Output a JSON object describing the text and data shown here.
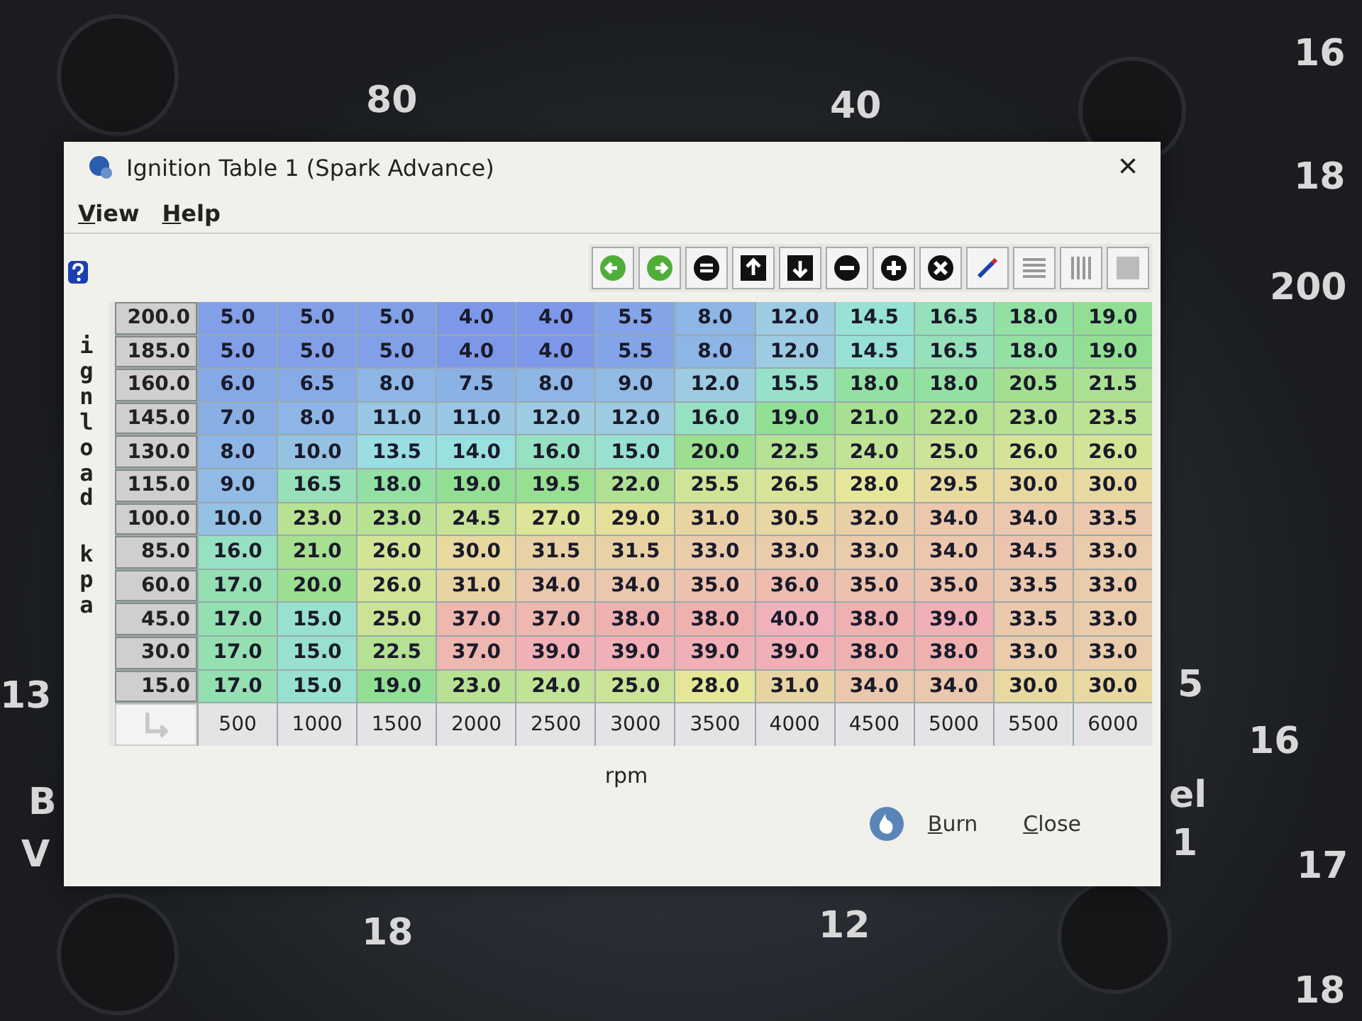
{
  "background": {
    "gauge_labels": [
      "80",
      "40",
      "16",
      "18",
      "200",
      "13",
      "B",
      "V",
      "16",
      "el",
      "1",
      "17",
      "5",
      "18",
      "12",
      "18"
    ]
  },
  "window": {
    "title": "Ignition Table 1 (Spark Advance)",
    "close": "×"
  },
  "menu": [
    "View",
    "Help"
  ],
  "table": {
    "y_axis_label": [
      "ignload",
      "kpa"
    ],
    "x_axis_label": "rpm",
    "rows": [
      {
        "load": "200.0",
        "cells": [
          "5.0",
          "5.0",
          "5.0",
          "4.0",
          "4.0",
          "5.5",
          "8.0",
          "12.0",
          "14.5",
          "16.5",
          "18.0",
          "19.0"
        ]
      },
      {
        "load": "185.0",
        "cells": [
          "5.0",
          "5.0",
          "5.0",
          "4.0",
          "4.0",
          "5.5",
          "8.0",
          "12.0",
          "14.5",
          "16.5",
          "18.0",
          "19.0"
        ]
      },
      {
        "load": "160.0",
        "cells": [
          "6.0",
          "6.5",
          "8.0",
          "7.5",
          "8.0",
          "9.0",
          "12.0",
          "15.5",
          "18.0",
          "18.0",
          "20.5",
          "21.5"
        ]
      },
      {
        "load": "145.0",
        "cells": [
          "7.0",
          "8.0",
          "11.0",
          "11.0",
          "12.0",
          "12.0",
          "16.0",
          "19.0",
          "21.0",
          "22.0",
          "23.0",
          "23.5"
        ]
      },
      {
        "load": "130.0",
        "cells": [
          "8.0",
          "10.0",
          "13.5",
          "14.0",
          "16.0",
          "15.0",
          "20.0",
          "22.5",
          "24.0",
          "25.0",
          "26.0",
          "26.0"
        ]
      },
      {
        "load": "115.0",
        "cells": [
          "9.0",
          "16.5",
          "18.0",
          "19.0",
          "19.5",
          "22.0",
          "25.5",
          "26.5",
          "28.0",
          "29.5",
          "30.0",
          "30.0"
        ]
      },
      {
        "load": "100.0",
        "cells": [
          "10.0",
          "23.0",
          "23.0",
          "24.5",
          "27.0",
          "29.0",
          "31.0",
          "30.5",
          "32.0",
          "34.0",
          "34.0",
          "33.5"
        ]
      },
      {
        "load": "85.0",
        "cells": [
          "16.0",
          "21.0",
          "26.0",
          "30.0",
          "31.5",
          "31.5",
          "33.0",
          "33.0",
          "33.0",
          "34.0",
          "34.5",
          "33.0"
        ]
      },
      {
        "load": "60.0",
        "cells": [
          "17.0",
          "20.0",
          "26.0",
          "31.0",
          "34.0",
          "34.0",
          "35.0",
          "36.0",
          "35.0",
          "35.0",
          "33.5",
          "33.0"
        ]
      },
      {
        "load": "45.0",
        "cells": [
          "17.0",
          "15.0",
          "25.0",
          "37.0",
          "37.0",
          "38.0",
          "38.0",
          "40.0",
          "38.0",
          "39.0",
          "33.5",
          "33.0"
        ]
      },
      {
        "load": "30.0",
        "cells": [
          "17.0",
          "15.0",
          "22.5",
          "37.0",
          "39.0",
          "39.0",
          "39.0",
          "39.0",
          "38.0",
          "38.0",
          "33.0",
          "33.0"
        ]
      },
      {
        "load": "15.0",
        "cells": [
          "17.0",
          "15.0",
          "19.0",
          "23.0",
          "24.0",
          "25.0",
          "28.0",
          "31.0",
          "34.0",
          "34.0",
          "30.0",
          "30.0"
        ]
      }
    ],
    "x_axis_values": [
      "500",
      "1000",
      "1500",
      "2000",
      "2500",
      "3000",
      "3500",
      "4000",
      "4500",
      "5000",
      "5500",
      "6000"
    ]
  },
  "buttons": [
    {
      "kind": "burn",
      "label": "Burn"
    },
    {
      "kind": "close",
      "label": "Close"
    }
  ]
}
